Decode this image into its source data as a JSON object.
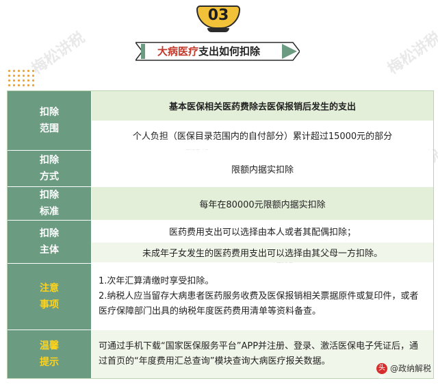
{
  "header": {
    "section_number": "03",
    "title_highlight": "大病医疗",
    "title_rest": "支出如何扣除"
  },
  "watermark": "梅松讲税",
  "rows": [
    {
      "label_line1": "扣除",
      "label_line2": "范围",
      "cells": [
        "基本医保相关医药费除去医保报销后发生的支出",
        "个人负担（医保目录范围内的自付部分）累计超过15000元的部分"
      ]
    },
    {
      "label_line1": "扣除",
      "label_line2": "方式",
      "cells": [
        "限额内据实扣除"
      ]
    },
    {
      "label_line1": "扣除",
      "label_line2": "标准",
      "cells": [
        "每年在80000元限额内据实扣除"
      ]
    },
    {
      "label_line1": "扣除",
      "label_line2": "主体",
      "cells": [
        "医药费用支出可以选择由本人或者其配偶扣除；",
        "未成年子女发生的医药费用支出可以选择由其父母一方扣除。"
      ]
    },
    {
      "label_line1": "注意",
      "label_line2": "事项",
      "cells": [
        "1.次年汇算清缴时享受扣除。",
        "2.纳税人应当留存大病患者医药服务收费及医保报销相关票据原件或复印件，或者医疗保障部门出具的纳税年度医药费用清单等资料备查。"
      ]
    },
    {
      "label_line1": "温馨",
      "label_line2": "提示",
      "cells": [
        "可通过手机下载“国家医保服务平台”APP并注册、登录、激活医保电子凭证后，通过首页的“年度费用汇总查询”模块查询大病医疗报关数据。"
      ]
    }
  ],
  "footer": {
    "logo_text": "头条",
    "account": "@政纳解税"
  },
  "colors": {
    "label_bg": "#6b9c82",
    "row_green": "#e4efd9",
    "row_light": "#f1f6ea",
    "highlight_label": "#ffd21c",
    "accent_gold": "#f2c13a"
  }
}
